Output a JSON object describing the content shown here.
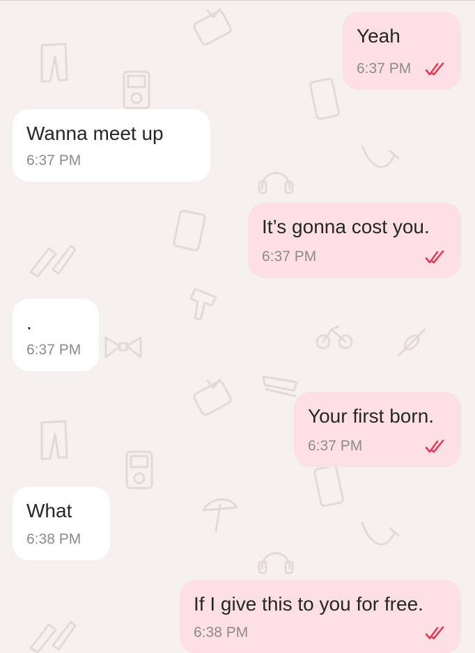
{
  "theme": {
    "background": "#f6f0f0",
    "incoming_bubble": "#ffffff",
    "outgoing_bubble": "#fde0e5",
    "read_check_color": "#e23b56"
  },
  "messages": [
    {
      "direction": "outgoing",
      "text": "Yeah",
      "time": "6:37 PM",
      "status": "read-double-check-icon"
    },
    {
      "direction": "incoming",
      "text": "Wanna meet up",
      "time": "6:37 PM"
    },
    {
      "direction": "outgoing",
      "text": "It’s gonna cost you.",
      "time": "6:37 PM",
      "status": "read-double-check-icon"
    },
    {
      "direction": "incoming",
      "text": ".",
      "time": "6:37 PM"
    },
    {
      "direction": "outgoing",
      "text": "Your first born.",
      "time": "6:37 PM",
      "status": "read-double-check-icon"
    },
    {
      "direction": "incoming",
      "text": "What",
      "time": "6:38 PM"
    },
    {
      "direction": "outgoing",
      "text": "If I give this to you for free.",
      "time": "6:38 PM",
      "status": "read-double-check-icon"
    }
  ],
  "wallpaper_icons": [
    "pants-icon",
    "mp3-player-icon",
    "tv-icon",
    "phone-icon",
    "headphones-icon",
    "saxophone-icon",
    "gameboy-icon",
    "bicycle-icon",
    "bow-tie-icon",
    "umbrella-icon",
    "candy-icon",
    "drill-icon"
  ]
}
